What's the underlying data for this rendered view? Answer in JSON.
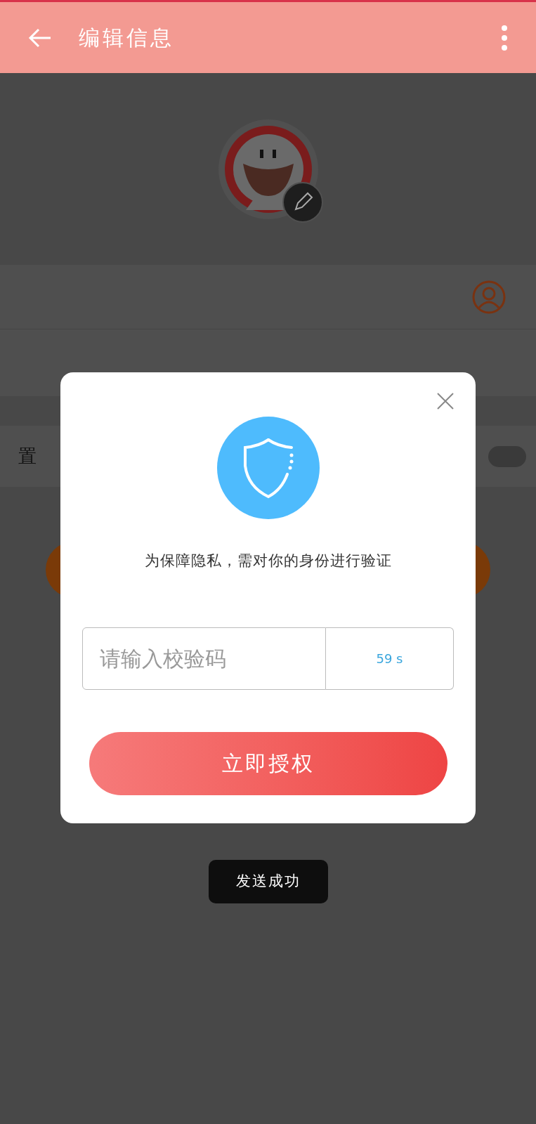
{
  "app_bar": {
    "title": "编辑信息"
  },
  "settings": [
    {
      "kind": "switch",
      "label": "置",
      "on": false
    }
  ],
  "dialog": {
    "message": "为保障隐私，需对你的身份进行验证",
    "code_field": {
      "placeholder": "请输入校验码"
    },
    "countdown": "59 s",
    "confirm_button": "立即授权"
  },
  "toast": "发送成功"
}
